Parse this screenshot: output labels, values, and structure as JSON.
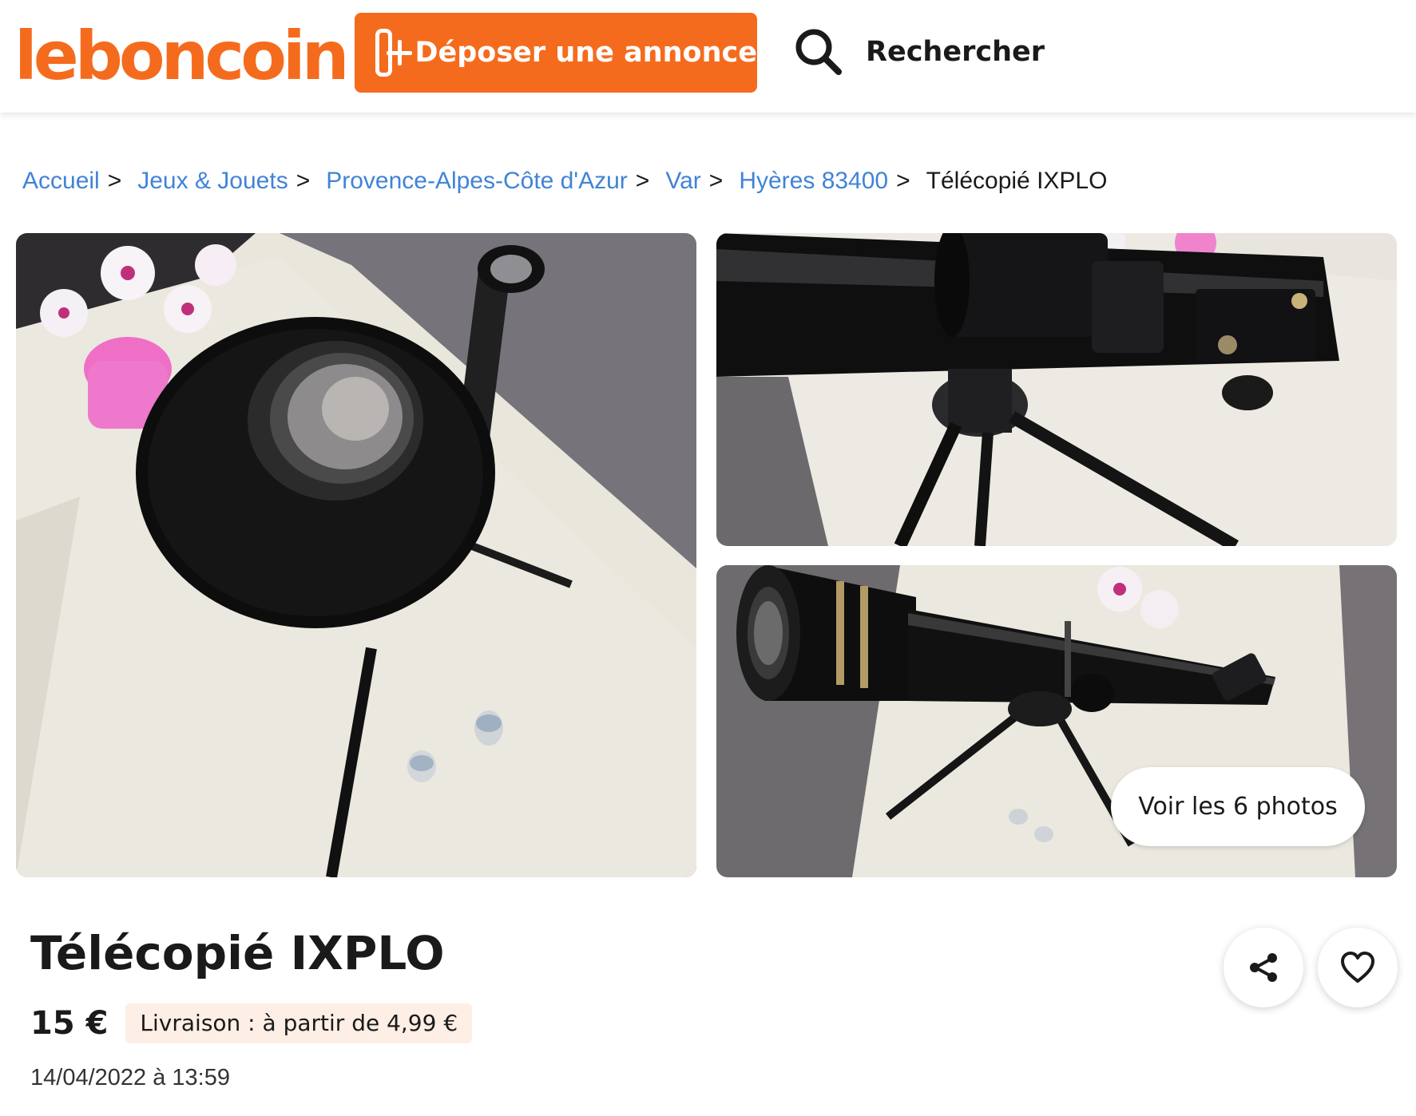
{
  "header": {
    "logo_text": "leboncoin",
    "post_button_label": "Déposer une annonce",
    "search_label": "Rechercher",
    "brand_color": "#f56b1d"
  },
  "breadcrumb": {
    "items": [
      "Accueil",
      "Jeux & Jouets",
      "Provence-Alpes-Côte d'Azur",
      "Var",
      "Hyères 83400"
    ],
    "current": "Télécopié IXPLO",
    "separator": ">"
  },
  "gallery": {
    "see_all_label": "Voir les 6 photos"
  },
  "listing": {
    "title": "Télécopié IXPLO",
    "price": "15 €",
    "delivery": "Livraison : à partir de 4,99 €",
    "date": "14/04/2022 à 13:59"
  },
  "icons": {
    "post": "plus-square-icon",
    "search": "search-icon",
    "share": "share-icon",
    "favorite": "heart-icon"
  }
}
